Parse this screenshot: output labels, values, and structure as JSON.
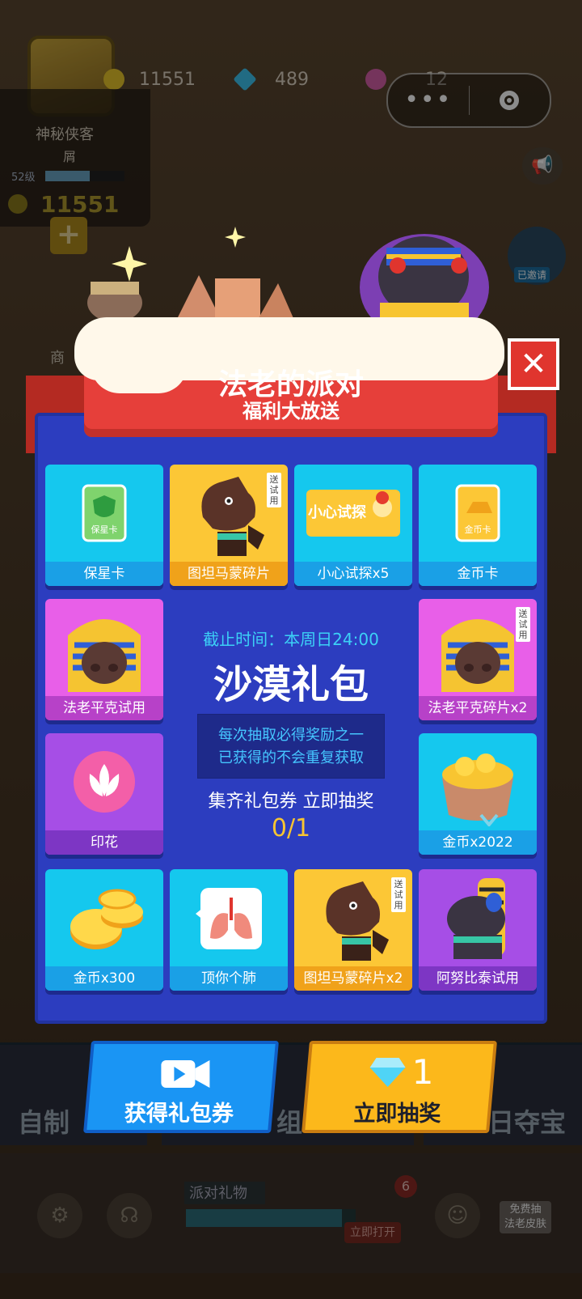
{
  "top": {
    "coins": "11551",
    "gems": "489",
    "stamps": "12"
  },
  "profile": {
    "name": "神秘侠客",
    "subtitle": "屑",
    "level": "52级",
    "coins": "11551"
  },
  "side": {
    "badge": "已邀请"
  },
  "modal": {
    "title": "法老的派对",
    "subtitle": "福利大放送",
    "close_icon": "close-x-icon",
    "deadline": "截止时间：本周日24:00",
    "pack_name": "沙漠礼包",
    "notice_line1": "每次抽取必得奖励之一",
    "notice_line2": "已获得的不会重复获取",
    "collect_text": "集齐礼包券 立即抽奖",
    "progress": "0/1",
    "items": [
      {
        "label": "保星卡",
        "icon": "star-card-icon",
        "art": "保星卡",
        "tag": ""
      },
      {
        "label": "图坦马蒙碎片",
        "icon": "horse-character-icon",
        "art": "",
        "tag": "送试用"
      },
      {
        "label": "小心试探x5",
        "icon": "careful-probe-card-icon",
        "art": "小心试探",
        "tag": ""
      },
      {
        "label": "金币卡",
        "icon": "gold-card-icon",
        "art": "金币卡",
        "tag": ""
      },
      {
        "label": "法老平克试用",
        "icon": "pharaoh-pig-icon",
        "art": "",
        "tag": ""
      },
      {
        "label": "法老平克碎片x2",
        "icon": "pharaoh-pig-icon",
        "art": "",
        "tag": "送试用"
      },
      {
        "label": "印花",
        "icon": "lotus-stamp-icon",
        "art": "",
        "tag": ""
      },
      {
        "label": "金币x2022",
        "icon": "coin-bag-icon",
        "art": "",
        "tag": ""
      },
      {
        "label": "金币x300",
        "icon": "coin-pile-icon",
        "art": "",
        "tag": ""
      },
      {
        "label": "顶你个肺",
        "icon": "lungs-icon",
        "art": "",
        "tag": ""
      },
      {
        "label": "图坦马蒙碎片x2",
        "icon": "horse-character-icon",
        "art": "",
        "tag": "送试用"
      },
      {
        "label": "阿努比泰试用",
        "icon": "anubis-character-icon",
        "art": "",
        "tag": ""
      }
    ]
  },
  "buttons": {
    "get_ticket": "获得礼包券",
    "draw_now": "立即抽奖",
    "draw_cost": "1"
  },
  "bottom": {
    "left_mode": "自制",
    "mid_mode": "组",
    "right_mode": "日夺宝",
    "party_gift": "派对礼物",
    "open_now": "立即打开",
    "gift_count": "6",
    "free_draw_line1": "免费抽",
    "free_draw_line2": "法老皮肤",
    "shop": "商"
  },
  "colors": {
    "modal_blue": "#2c3dbf",
    "banner_red": "#e63f3a",
    "tile_cyan": "#15c8ee",
    "tile_yellow": "#fcc736",
    "tile_pink": "#e85fe8",
    "tile_purple": "#a64ee6",
    "button_blue": "#1a95f4",
    "button_yellow": "#fcb81b",
    "deadline_cyan": "#3cd1f6",
    "progress_gold": "#f8c531"
  }
}
